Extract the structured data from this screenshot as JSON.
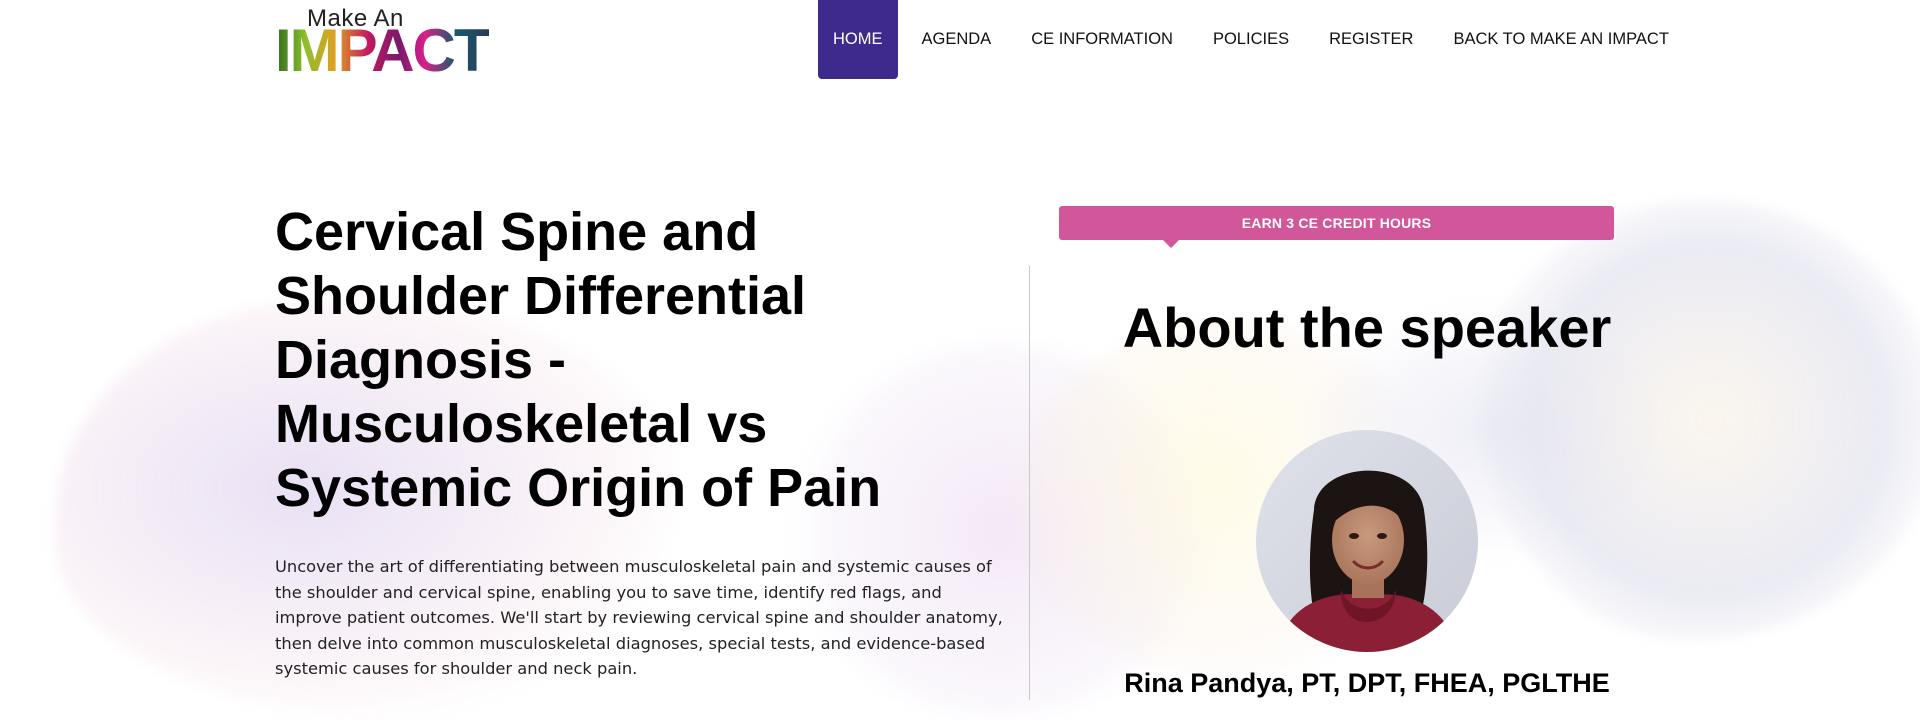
{
  "logo": {
    "small_text": "Make An",
    "big_text": "IMPACT"
  },
  "nav": {
    "items": [
      {
        "label": "HOME"
      },
      {
        "label": "AGENDA"
      },
      {
        "label": "CE INFORMATION"
      },
      {
        "label": "POLICIES"
      },
      {
        "label": "REGISTER"
      },
      {
        "label": "BACK TO MAKE AN IMPACT"
      }
    ],
    "active_color": "#3d2a8c"
  },
  "course": {
    "title": "Cervical Spine and Shoulder Differential Diagnosis - Musculoskeletal vs Systemic Origin of Pain",
    "description": "Uncover the art of differentiating between musculoskeletal pain and systemic causes of the shoulder and cervical spine, enabling you to save time, identify red flags, and improve patient outcomes. We'll start by reviewing cervical spine and shoulder anatomy, then delve into common musculoskeletal diagnoses, special tests, and evidence-based systemic causes for shoulder and neck pain."
  },
  "ce_badge": {
    "label": "EARN 3 CE CREDIT HOURS",
    "color": "#d2569a"
  },
  "speaker": {
    "heading": "About the speaker",
    "name": "Rina Pandya, PT, DPT, FHEA, PGLTHE"
  }
}
